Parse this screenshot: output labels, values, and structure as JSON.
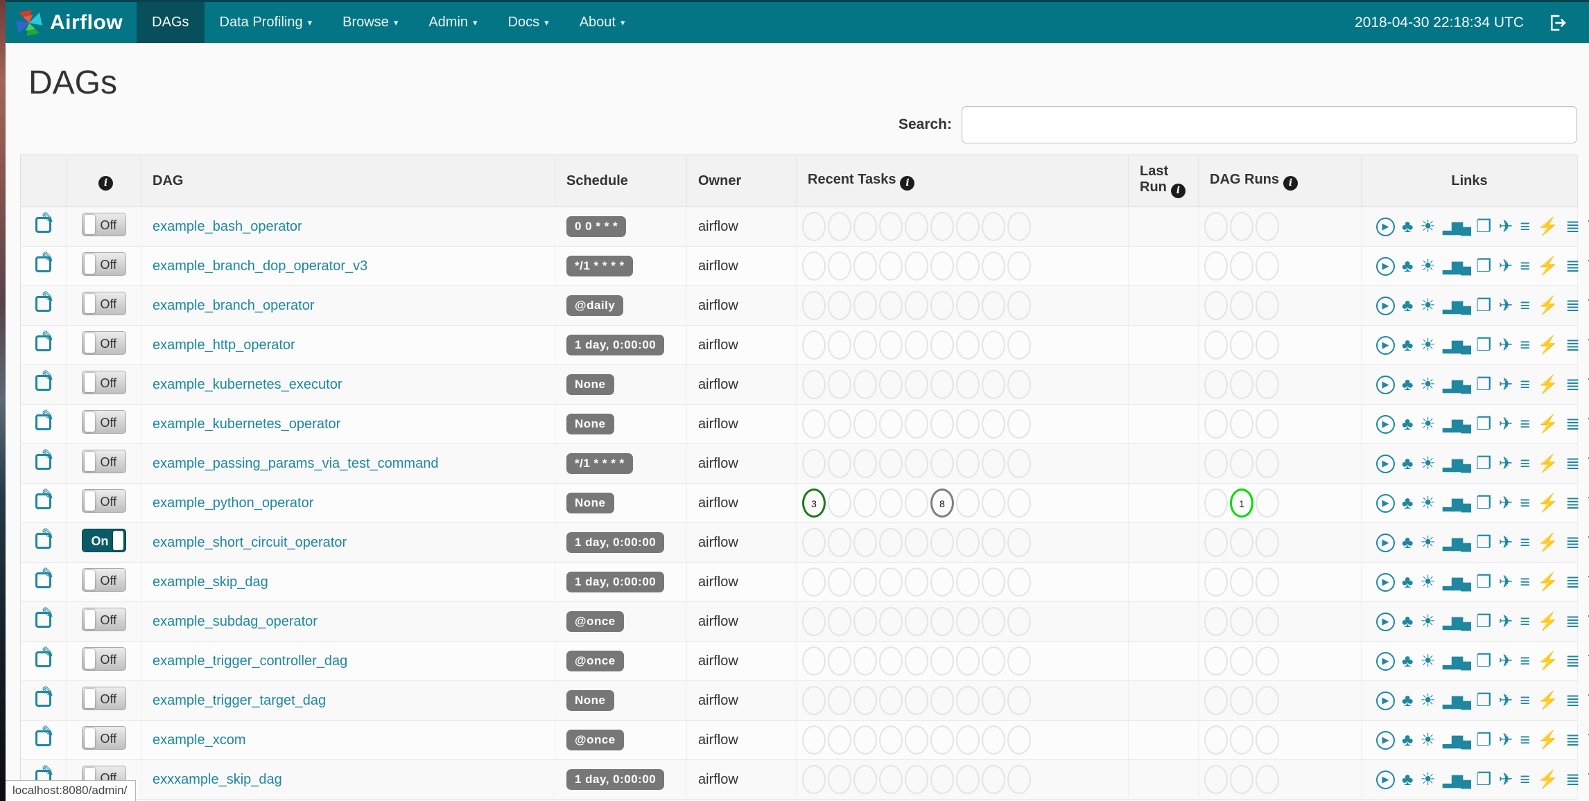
{
  "navbar": {
    "brand": "Airflow",
    "items": [
      {
        "label": "DAGs",
        "active": true,
        "caret": false
      },
      {
        "label": "Data Profiling",
        "active": false,
        "caret": true
      },
      {
        "label": "Browse",
        "active": false,
        "caret": true
      },
      {
        "label": "Admin",
        "active": false,
        "caret": true
      },
      {
        "label": "Docs",
        "active": false,
        "caret": true
      },
      {
        "label": "About",
        "active": false,
        "caret": true
      }
    ],
    "caret_glyph": "▾",
    "clock": "2018-04-30 22:18:34 UTC"
  },
  "page": {
    "title": "DAGs",
    "search_label": "Search:",
    "search_value": ""
  },
  "table": {
    "headers": {
      "edit": "",
      "dag": "DAG",
      "schedule": "Schedule",
      "owner": "Owner",
      "recent_tasks": "Recent Tasks",
      "last_run": "Last Run",
      "dag_runs": "DAG Runs",
      "links": "Links"
    },
    "info_glyph": "i",
    "toggle_on_label": "On",
    "toggle_off_label": "Off",
    "edit_glyph": "✎",
    "recent_slot_count": 9,
    "run_slot_count": 3,
    "link_icons": [
      {
        "name": "trigger-dag-icon",
        "glyph": "▶",
        "style": "circled"
      },
      {
        "name": "tree-view-icon",
        "glyph": "♣",
        "style": ""
      },
      {
        "name": "graph-view-icon",
        "glyph": "☀",
        "style": ""
      },
      {
        "name": "task-duration-icon",
        "glyph": "▂▆▄",
        "style": "bars"
      },
      {
        "name": "task-tries-icon",
        "glyph": "❐",
        "style": ""
      },
      {
        "name": "landing-times-icon",
        "glyph": "✈",
        "style": ""
      },
      {
        "name": "gantt-icon",
        "glyph": "≡",
        "style": ""
      },
      {
        "name": "code-icon",
        "glyph": "⚡",
        "style": ""
      },
      {
        "name": "dag-details-icon",
        "glyph": "≣",
        "style": ""
      },
      {
        "name": "refresh-icon",
        "glyph": "↻",
        "style": ""
      }
    ],
    "rows": [
      {
        "name": "example_bash_operator",
        "schedule": "0 0 * * *",
        "owner": "airflow",
        "toggle": "off",
        "recent_tasks": [],
        "dag_runs": []
      },
      {
        "name": "example_branch_dop_operator_v3",
        "schedule": "*/1 * * * *",
        "owner": "airflow",
        "toggle": "off",
        "recent_tasks": [],
        "dag_runs": []
      },
      {
        "name": "example_branch_operator",
        "schedule": "@daily",
        "owner": "airflow",
        "toggle": "off",
        "recent_tasks": [],
        "dag_runs": []
      },
      {
        "name": "example_http_operator",
        "schedule": "1 day, 0:00:00",
        "owner": "airflow",
        "toggle": "off",
        "recent_tasks": [],
        "dag_runs": []
      },
      {
        "name": "example_kubernetes_executor",
        "schedule": "None",
        "owner": "airflow",
        "toggle": "off",
        "recent_tasks": [],
        "dag_runs": []
      },
      {
        "name": "example_kubernetes_operator",
        "schedule": "None",
        "owner": "airflow",
        "toggle": "off",
        "recent_tasks": [],
        "dag_runs": []
      },
      {
        "name": "example_passing_params_via_test_command",
        "schedule": "*/1 * * * *",
        "owner": "airflow",
        "toggle": "off",
        "recent_tasks": [],
        "dag_runs": []
      },
      {
        "name": "example_python_operator",
        "schedule": "None",
        "owner": "airflow",
        "toggle": "off",
        "recent_tasks": [
          {
            "slot": 0,
            "count": "3",
            "state": "success",
            "color": "#1b7a1b"
          },
          {
            "slot": 5,
            "count": "8",
            "state": "queued",
            "color": "#7f7f7f"
          }
        ],
        "dag_runs": [
          {
            "slot": 1,
            "count": "1",
            "state": "running",
            "color": "#00dd00"
          }
        ]
      },
      {
        "name": "example_short_circuit_operator",
        "schedule": "1 day, 0:00:00",
        "owner": "airflow",
        "toggle": "on",
        "recent_tasks": [],
        "dag_runs": []
      },
      {
        "name": "example_skip_dag",
        "schedule": "1 day, 0:00:00",
        "owner": "airflow",
        "toggle": "off",
        "recent_tasks": [],
        "dag_runs": []
      },
      {
        "name": "example_subdag_operator",
        "schedule": "@once",
        "owner": "airflow",
        "toggle": "off",
        "recent_tasks": [],
        "dag_runs": []
      },
      {
        "name": "example_trigger_controller_dag",
        "schedule": "@once",
        "owner": "airflow",
        "toggle": "off",
        "recent_tasks": [],
        "dag_runs": []
      },
      {
        "name": "example_trigger_target_dag",
        "schedule": "None",
        "owner": "airflow",
        "toggle": "off",
        "recent_tasks": [],
        "dag_runs": []
      },
      {
        "name": "example_xcom",
        "schedule": "@once",
        "owner": "airflow",
        "toggle": "off",
        "recent_tasks": [],
        "dag_runs": []
      },
      {
        "name": "exxxample_skip_dag",
        "schedule": "1 day, 0:00:00",
        "owner": "airflow",
        "toggle": "off",
        "recent_tasks": [],
        "dag_runs": []
      }
    ]
  },
  "status_bar": "localhost:8080/admin/",
  "colors": {
    "navbar": "#047585",
    "navbar_active": "#07505b",
    "link_teal": "#1f87a0",
    "badge_gray": "#777777",
    "success_green": "#1b7a1b",
    "running_lime": "#00dd00",
    "queued_gray": "#7f7f7f"
  }
}
